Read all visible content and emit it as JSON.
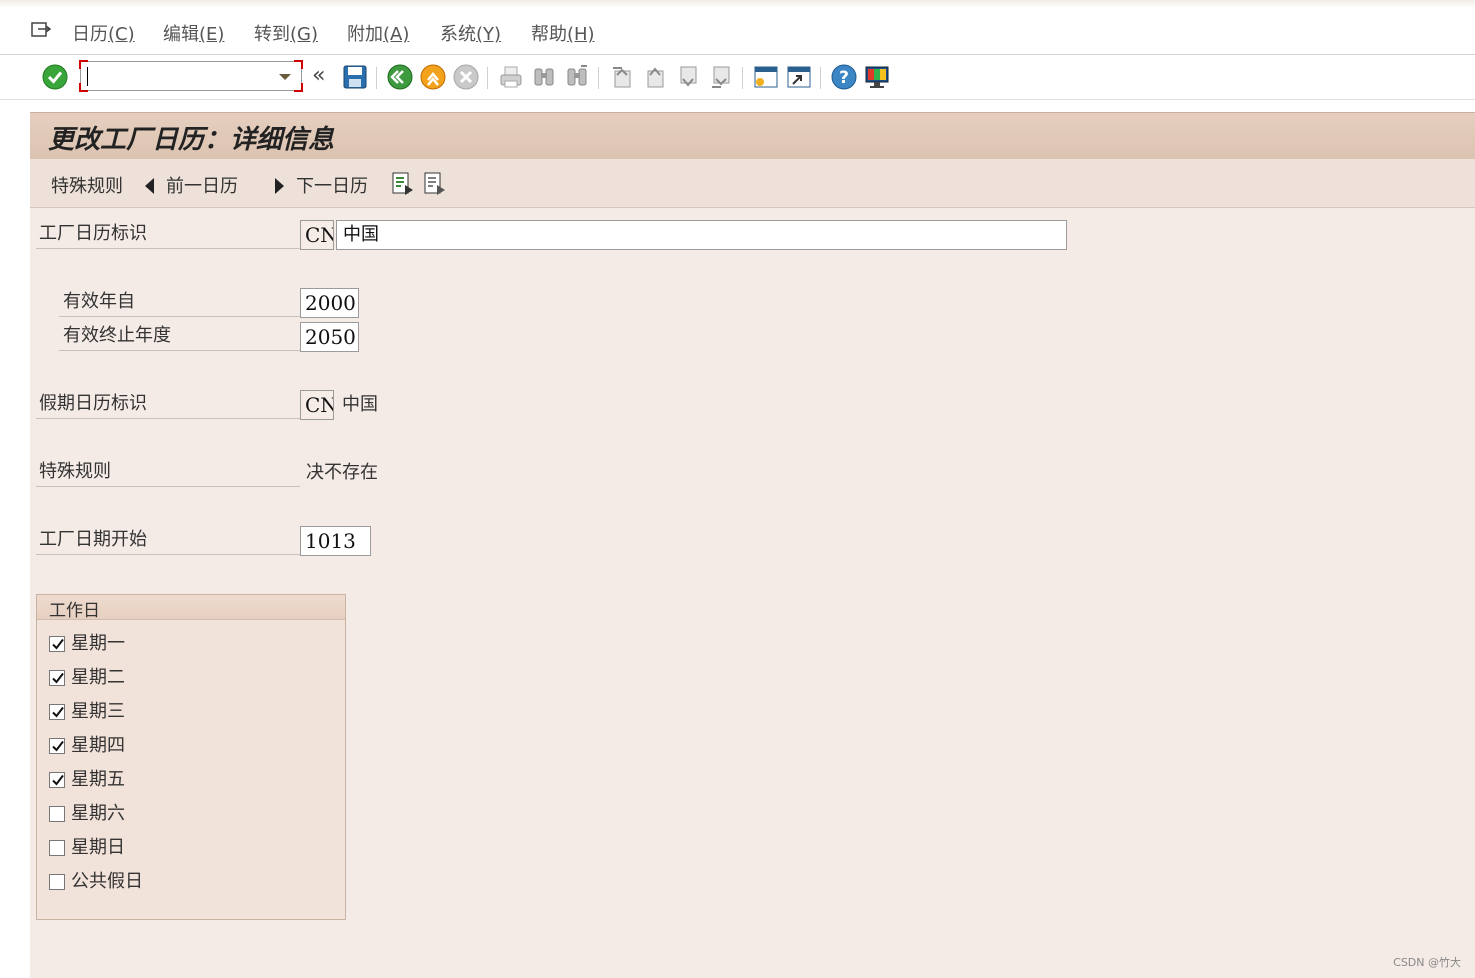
{
  "menu": {
    "items": [
      {
        "label": "日历",
        "accel": "(C)"
      },
      {
        "label": "编辑",
        "accel": "(E)"
      },
      {
        "label": "转到",
        "accel": "(G)"
      },
      {
        "label": "附加",
        "accel": "(A)"
      },
      {
        "label": "系统",
        "accel": "(Y)"
      },
      {
        "label": "帮助",
        "accel": "(H)"
      }
    ]
  },
  "toolbar": {
    "command_value": "",
    "collapse_glyph": "«"
  },
  "screen": {
    "title": "更改工厂日历：详细信息"
  },
  "appbar": {
    "special_rules": "特殊规则",
    "prev_calendar": "前一日历",
    "next_calendar": "下一日历"
  },
  "form": {
    "factory_calendar_label": "工厂日历标识",
    "factory_calendar_id": "CN",
    "factory_calendar_desc": "中国",
    "valid_from_label": "有效年自",
    "valid_from": "2000",
    "valid_to_label": "有效终止年度",
    "valid_to": "2050",
    "holiday_calendar_label": "假期日历标识",
    "holiday_calendar_id": "CN",
    "holiday_calendar_desc": "中国",
    "special_rules_label": "特殊规则",
    "special_rules_value": "决不存在",
    "factory_date_start_label": "工厂日期开始",
    "factory_date_start": "1013"
  },
  "workdays": {
    "title": "工作日",
    "days": [
      {
        "label": "星期一",
        "checked": true
      },
      {
        "label": "星期二",
        "checked": true
      },
      {
        "label": "星期三",
        "checked": true
      },
      {
        "label": "星期四",
        "checked": true
      },
      {
        "label": "星期五",
        "checked": true
      },
      {
        "label": "星期六",
        "checked": false
      },
      {
        "label": "星期日",
        "checked": false
      },
      {
        "label": "公共假日",
        "checked": false
      }
    ]
  },
  "watermark": "CSDN @竹大"
}
